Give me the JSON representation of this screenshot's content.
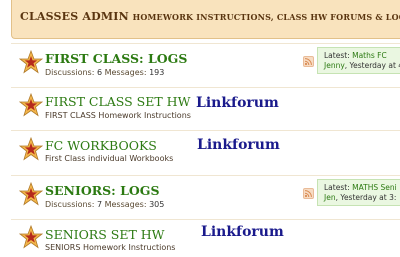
{
  "header": {
    "title_main": "CLASSES ADMIN",
    "title_sub": "Homework instructions, class HW forums & logs"
  },
  "forums": [
    {
      "title": "FIRST CLASS: LOGS",
      "discussions_label": "Discussions:",
      "discussions": "6",
      "messages_label": "Messages:",
      "messages": "193",
      "latest_label": "Latest:",
      "latest_topic": "Maths FC",
      "latest_user": "Jenny",
      "latest_time": ", Yesterday at 4"
    },
    {
      "title": "FIRST CLASS SET HW",
      "description": "FIRST CLASS Homework Instructions",
      "linkforum": "Linkforum"
    },
    {
      "title": "FC WORKBOOKS",
      "description": "First Class individual Workbooks",
      "linkforum": "Linkforum"
    },
    {
      "title": "SENIORS: LOGS",
      "discussions_label": "Discussions:",
      "discussions": "7",
      "messages_label": "Messages:",
      "messages": "305",
      "latest_label": "Latest:",
      "latest_topic": "MATHS Seni",
      "latest_user": "Jen",
      "latest_time": ", Yesterday at 3:"
    },
    {
      "title": "SENIORS SET HW",
      "description": "SENIORS Homework Instructions",
      "linkforum": "Linkforum"
    }
  ],
  "colors": {
    "header_bg": "#f9e3bd",
    "forum_title": "#2c7a12",
    "linkforum": "#1a1a8c",
    "latest_bg": "#eaf7e1"
  },
  "icons": {
    "forum": "star-icon",
    "feed": "rss-icon"
  }
}
